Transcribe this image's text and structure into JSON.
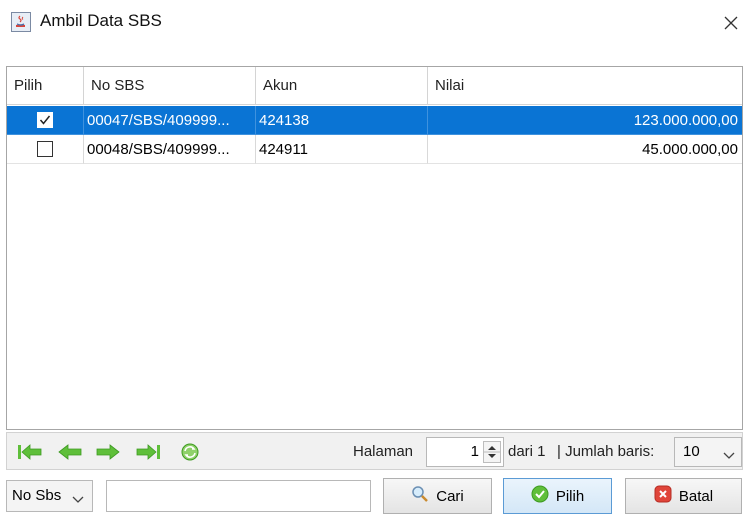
{
  "window": {
    "title": "Ambil Data SBS"
  },
  "table": {
    "columns": [
      "Pilih",
      "No SBS",
      "Akun",
      "Nilai"
    ],
    "rows": [
      {
        "checked": true,
        "no_sbs": "00047/SBS/409999...",
        "akun": "424138",
        "nilai": "123.000.000,00",
        "selected": true
      },
      {
        "checked": false,
        "no_sbs": "00048/SBS/409999...",
        "akun": "424911",
        "nilai": "45.000.000,00",
        "selected": false
      }
    ]
  },
  "pagination": {
    "halaman_label": "Halaman",
    "page": "1",
    "dari_label": "dari 1",
    "jumlah_label": "| Jumlah baris:",
    "rows_per_page": "10"
  },
  "search": {
    "field": "No Sbs",
    "query": "",
    "cari_label": "Cari",
    "pilih_label": "Pilih",
    "batal_label": "Batal"
  },
  "colors": {
    "selection": "#0a74d4",
    "nav_green": "#5fbf3a",
    "cancel_red": "#e0453a"
  },
  "icons": [
    "java-cup-icon",
    "close-icon",
    "first-page-icon",
    "prev-page-icon",
    "next-page-icon",
    "last-page-icon",
    "refresh-icon",
    "search-icon",
    "ok-icon",
    "cancel-icon"
  ]
}
